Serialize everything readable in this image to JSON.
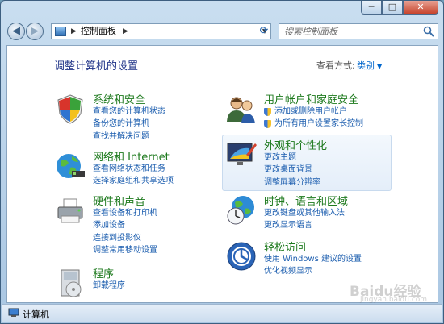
{
  "window": {
    "min_label": "─",
    "max_label": "□",
    "close_label": "✕"
  },
  "nav": {
    "back_label": "◀",
    "forward_label": "▶",
    "breadcrumb": "控制面板",
    "refresh_label": "⟳"
  },
  "search": {
    "placeholder": "搜索控制面板"
  },
  "main": {
    "heading": "调整计算机的设置",
    "view_by_label": "查看方式:",
    "view_by_value": "类别"
  },
  "categories": [
    {
      "title": "系统和安全",
      "icon": "shield-icon",
      "links": [
        "查看您的计算机状态",
        "备份您的计算机",
        "查找并解决问题"
      ]
    },
    {
      "title": "网络和 Internet",
      "icon": "network-globe-icon",
      "links": [
        "查看网络状态和任务",
        "选择家庭组和共享选项"
      ]
    },
    {
      "title": "硬件和声音",
      "icon": "printer-icon",
      "links": [
        "查看设备和打印机",
        "添加设备",
        "连接到投影仪",
        "调整常用移动设置"
      ]
    },
    {
      "title": "程序",
      "icon": "programs-icon",
      "links": [
        "卸载程序"
      ]
    },
    {
      "title": "用户帐户和家庭安全",
      "icon": "users-icon",
      "links": [
        "添加或删除用户帐户",
        "为所有用户设置家长控制"
      ]
    },
    {
      "title": "外观和个性化",
      "icon": "appearance-icon",
      "links": [
        "更改主题",
        "更改桌面背景",
        "调整屏幕分辨率"
      ]
    },
    {
      "title": "时钟、语言和区域",
      "icon": "clock-globe-icon",
      "links": [
        "更改键盘或其他输入法",
        "更改显示语言"
      ]
    },
    {
      "title": "轻松访问",
      "icon": "ease-of-access-icon",
      "links": [
        "使用 Windows 建议的设置",
        "优化视频显示"
      ]
    }
  ],
  "status_bar": {
    "label": "计算机"
  },
  "watermark": {
    "text": "Baidu经验",
    "sub": "jingyan.baidu.com"
  }
}
